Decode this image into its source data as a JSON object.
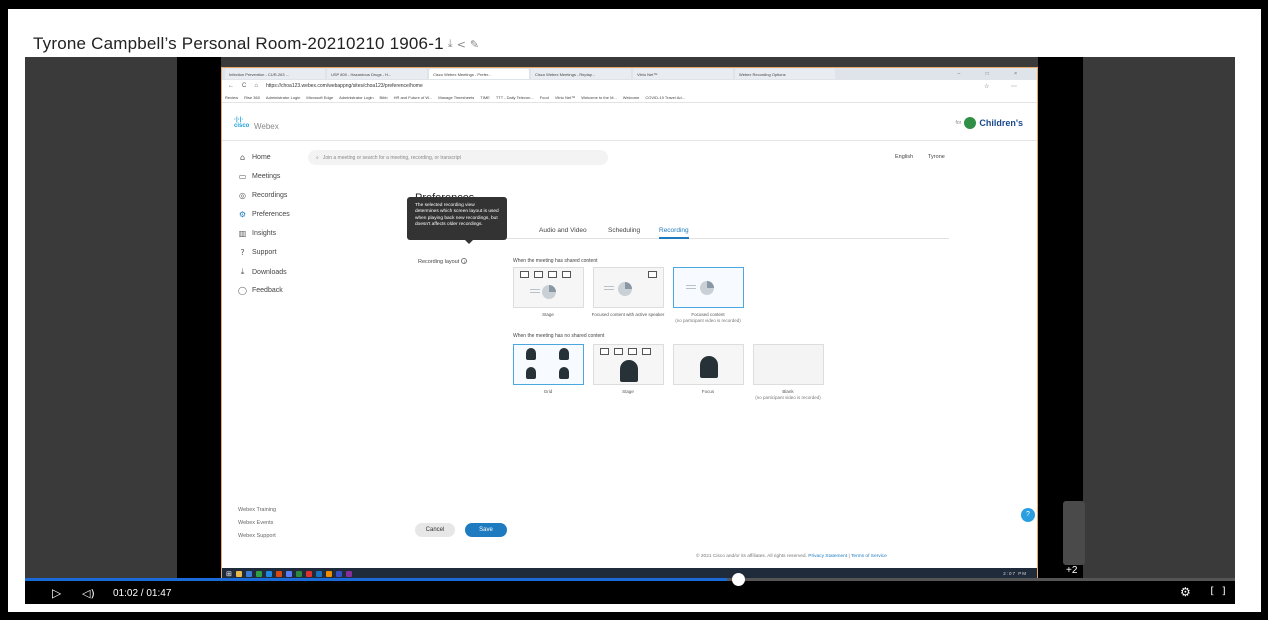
{
  "video": {
    "title": "Tyrone Campbell’s Personal Room-20210210 1906-1",
    "time": "01:02 / 01:47",
    "progress": 0.58,
    "participants_more": "+2",
    "icons": [
      "download-icon",
      "share-icon",
      "edit-icon",
      "play-icon",
      "volume-icon",
      "settings-icon",
      "fullscreen-icon"
    ]
  },
  "browser": {
    "tabs": [
      "Infection Prevention - CUR-263 ...",
      "USP 800 - Hazardous Drugs - H...",
      "Cisco Webex Meetings - Prefer...",
      "Cisco Webex Meetings - Replay...",
      "Vitrio Net™",
      "Webex Recording Options"
    ],
    "url": "https://choa123.webex.com/webappng/sites/choa123/preference/home",
    "bookmarks": [
      "Review",
      "Rise 360",
      "Administrator Login",
      "Microsoft Edge",
      "Administrator Login",
      "Bibb",
      "HR and Future of W...",
      "Manage Timesheets",
      "TIME",
      "TTT - Daily Televon...",
      "Food",
      "Vitrio Net™",
      "Welcome to the M...",
      "Welcome",
      "COVID-19 Travel Ad..."
    ]
  },
  "webex": {
    "brand": "Webex",
    "for": "for",
    "org": "Children's",
    "nav": [
      "Home",
      "Meetings",
      "Recordings",
      "Preferences",
      "Insights",
      "Support",
      "Downloads",
      "Feedback"
    ],
    "footer_links": [
      "Webex Training",
      "Webex Events",
      "Webex Support"
    ],
    "search_placeholder": "Join a meeting or search for a meeting, recording, or transcript",
    "language": "English",
    "user": "Tyrone",
    "page_title": "Preferences",
    "pref_tabs": [
      "Audio and Video",
      "Scheduling",
      "Recording"
    ],
    "tooltip": "The selected recording view determines which screen layout is used when playing back new recordings, but doesn't affects older recordings.",
    "recording_layout_label": "Recording layout",
    "shared_label": "When the meeting has shared content",
    "no_shared_label": "When the meeting has no shared content",
    "shared_options": [
      {
        "caption": "Stage",
        "sub": ""
      },
      {
        "caption": "Focused content with active speaker",
        "sub": ""
      },
      {
        "caption": "Focused content",
        "sub": "(no participant video is recorded)"
      }
    ],
    "no_shared_options": [
      {
        "caption": "Grid",
        "sub": ""
      },
      {
        "caption": "Stage",
        "sub": ""
      },
      {
        "caption": "Focus",
        "sub": ""
      },
      {
        "caption": "Blank",
        "sub": "(no participant video is recorded)"
      }
    ],
    "cancel": "Cancel",
    "save": "Save",
    "copyright": "© 2021 Cisco and/or its affiliates. All rights reserved.",
    "privacy": "Privacy Statement",
    "terms": "Terms of Service",
    "clock": "2:07 PM"
  }
}
